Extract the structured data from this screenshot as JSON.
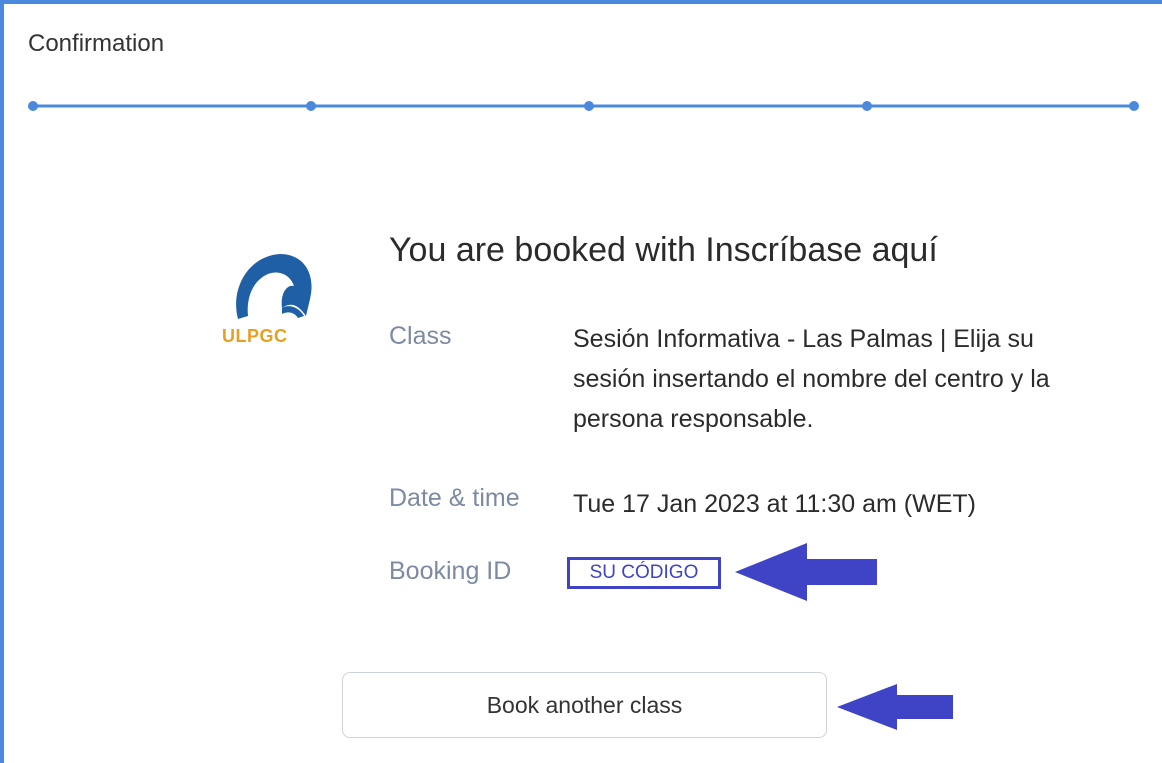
{
  "header": {
    "title": "Confirmation"
  },
  "progress": {
    "steps_total": 5,
    "steps_completed": 5,
    "color": "#4a89dc"
  },
  "logo": {
    "text": "ULPGC",
    "icon": "ulpgc-logo-icon",
    "color_mark": "#1f5fa5",
    "color_text": "#e8a020"
  },
  "booking": {
    "title": "You are booked with Inscríbase aquí",
    "class_label": "Class",
    "class_value": "Sesión Informativa - Las Palmas | Elija su sesión insertando el nombre del centro y la persona responsable.",
    "date_label": "Date & time",
    "date_value": "Tue 17 Jan 2023 at 11:30 am (WET)",
    "id_label": "Booking ID",
    "id_value": "SU CÓDIGO"
  },
  "actions": {
    "book_another_label": "Book another class"
  },
  "annotations": {
    "arrow_color": "#3f43c6",
    "arrow_icon": "left-arrow-icon"
  }
}
